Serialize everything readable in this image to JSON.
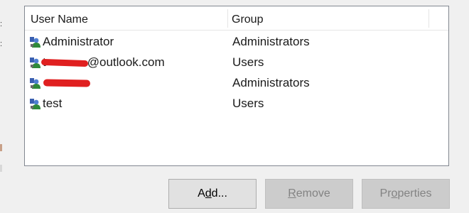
{
  "list": {
    "columns": {
      "user_name": "User Name",
      "group": "Group"
    },
    "rows": [
      {
        "user": "Administrator",
        "group": "Administrators"
      },
      {
        "user_prefix": "t",
        "user_suffix": "@outlook.com",
        "group": "Users"
      },
      {
        "user": "",
        "group": "Administrators"
      },
      {
        "user": "test",
        "group": "Users"
      }
    ]
  },
  "buttons": {
    "add": {
      "pre": "A",
      "accel": "d",
      "post": "d..."
    },
    "remove": {
      "pre": "",
      "accel": "R",
      "post": "emove"
    },
    "properties": {
      "pre": "Pr",
      "accel": "o",
      "post": "perties"
    }
  },
  "colors": {
    "redaction": "#e02020",
    "disabled_text": "#838383"
  },
  "icons": {
    "user": "user-account-icon"
  }
}
